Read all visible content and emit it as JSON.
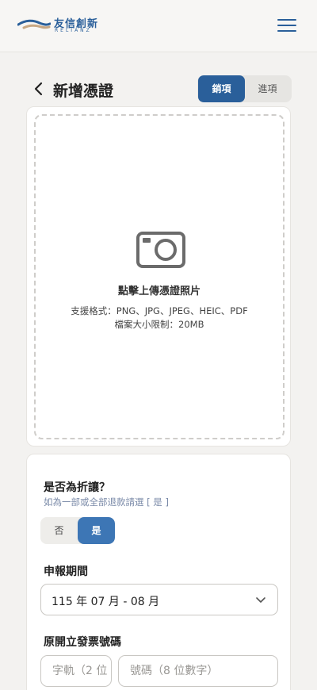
{
  "header": {
    "logo_text": "友信創新",
    "logo_sub": "RELIANZ",
    "menu_icon": "hamburger-menu-icon"
  },
  "page": {
    "title": "新增憑證",
    "back_icon": "chevron-left-icon"
  },
  "type_switch": {
    "active": "銷項",
    "inactive": "進項"
  },
  "upload": {
    "icon": "camera-icon",
    "title": "點擊上傳憑證照片",
    "formats": "支援格式：PNG、JPG、JPEG、HEIC、PDF",
    "size_limit": "檔案大小限制：20MB"
  },
  "form": {
    "discount": {
      "label": "是否為折讓？",
      "hint": "如為一部或全部退款請選 [ 是 ]",
      "no_label": "否",
      "yes_label": "是",
      "selected": "是"
    },
    "period": {
      "label": "申報期間",
      "value": "115 年 07 月 - 08 月"
    },
    "invoice": {
      "label": "原開立發票號碼",
      "track_placeholder": "字軌（2 位",
      "number_placeholder": "號碼（8 位數字）"
    }
  },
  "colors": {
    "brand": "#2a5f9a",
    "toggle_active": "#3d76b5",
    "background": "#f3f2f0"
  }
}
